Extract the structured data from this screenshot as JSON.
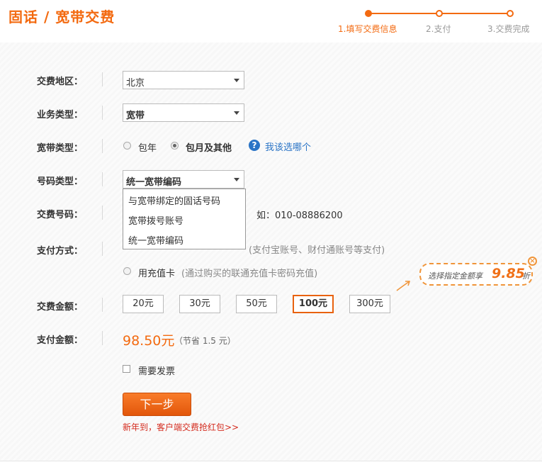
{
  "title": "固话 / 宽带交费",
  "steps": [
    {
      "label": "1.填写交费信息",
      "active": true
    },
    {
      "label": "2.支付",
      "active": false
    },
    {
      "label": "3.交费完成",
      "active": false
    }
  ],
  "form": {
    "region": {
      "label": "交费地区：",
      "value": "北京"
    },
    "service_type": {
      "label": "业务类型：",
      "value": "宽带"
    },
    "broadband_type": {
      "label": "宽带类型：",
      "options": [
        "包年",
        "包月及其他"
      ],
      "selected": "包月及其他",
      "help_text": "我该选哪个"
    },
    "number_type": {
      "label": "号码类型：",
      "value": "统一宽带编码",
      "dropdown_options": [
        "与宽带绑定的固话号码",
        "宽带拨号账号",
        "统一宽带编码"
      ]
    },
    "pay_number": {
      "label": "交费号码：",
      "hint": "如：010-08886200"
    },
    "pay_method": {
      "label": "支付方式：",
      "option1_hint": "(支付宝账号、财付通账号等支付)",
      "option2": "用充值卡",
      "option2_hint": "(通过购买的联通充值卡密码充值)"
    },
    "amount": {
      "label": "交费金额：",
      "options": [
        "20元",
        "30元",
        "50元",
        "100元",
        "300元"
      ],
      "selected": "100元"
    },
    "pay_amount": {
      "label": "支付金额：",
      "value": "98.50元",
      "saving": "（节省 1.5 元）"
    },
    "invoice": {
      "label": "需要发票",
      "checked": false
    }
  },
  "next_button": "下一步",
  "promo_link": "新年到，客户端交费抢红包>>",
  "discount_bubble": {
    "text": "选择指定金额享",
    "value": "9.85",
    "suffix": "折"
  },
  "colors": {
    "accent": "#f36a10",
    "link": "#2a74c6",
    "promo": "#d42b1e"
  }
}
